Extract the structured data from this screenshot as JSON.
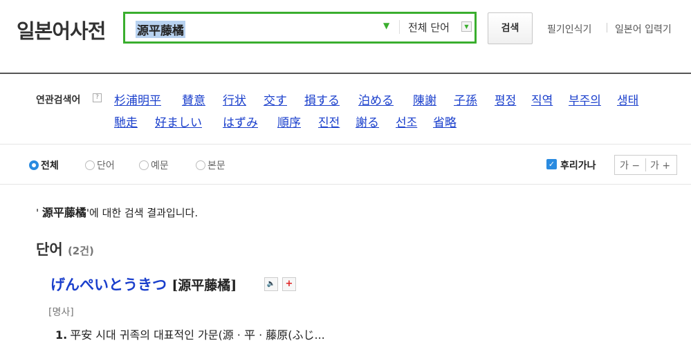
{
  "header": {
    "logo": "일본어사전",
    "search": {
      "query": "源平藤橘",
      "scope": "전체 단어"
    },
    "search_button": "검색",
    "links": [
      "필기인식기",
      "일본어 입력기"
    ]
  },
  "related": {
    "label": "연관검색어",
    "help": "?",
    "terms": [
      "杉浦明平",
      "賛意",
      "行状",
      "交す",
      "損する",
      "泊める",
      "陳謝",
      "子孫",
      "평정",
      "직역",
      "부주의",
      "생태",
      "馳走",
      "好ましい",
      "はずみ",
      "順序",
      "진전",
      "謝る",
      "선조",
      "省略"
    ]
  },
  "filters": {
    "options": [
      "전체",
      "단어",
      "예문",
      "본문"
    ],
    "selected": "전체",
    "furigana_label": "후리가나",
    "furigana_checked": true,
    "size_down": "가 −",
    "size_up": "가 +"
  },
  "result_summary": {
    "quote_open": "' ",
    "query": "源平藤橘",
    "suffix": "'에 대한 검색 결과입니다."
  },
  "section": {
    "title": "단어",
    "count": "(2건)"
  },
  "entry": {
    "reading": "げんぺいとうきつ",
    "kanji": "[源平藤橘]",
    "part_of_speech": "[명사]",
    "definition_number": "1.",
    "definition": "平安 시대 귀족의 대표적인 가문(源 · 平 · 藤原(ふじ..."
  },
  "colors": {
    "accent_green": "#3aae2e",
    "link_blue": "#1a3fcc",
    "check_blue": "#2a8be0"
  }
}
